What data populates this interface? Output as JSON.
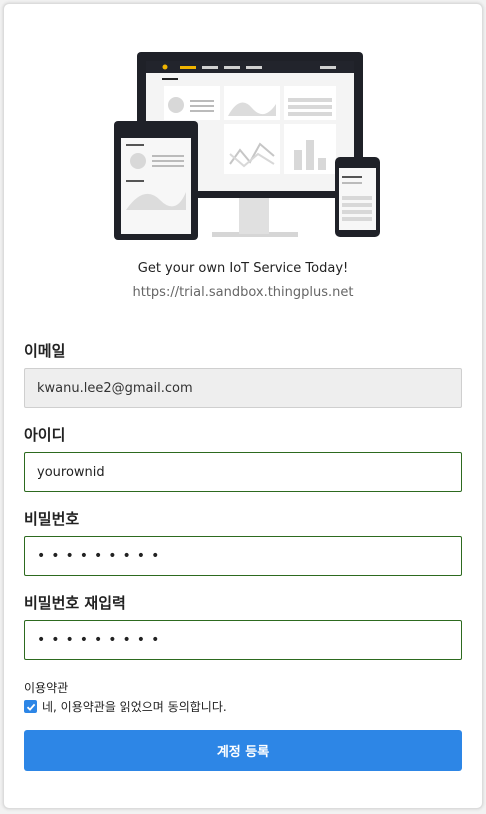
{
  "hero": {
    "tagline": "Get your own IoT Service Today!",
    "url": "https://trial.sandbox.thingplus.net"
  },
  "form": {
    "email": {
      "label": "이메일",
      "value": "kwanu.lee2@gmail.com"
    },
    "userid": {
      "label": "아이디",
      "value": "yourownid"
    },
    "password": {
      "label": "비밀번호",
      "value": "•••••••••"
    },
    "password_confirm": {
      "label": "비밀번호 재입력",
      "value": "•••••••••"
    },
    "terms": {
      "title": "이용약관",
      "agree_label": "네, 이용약관을 읽었으며 동의합니다.",
      "checked": true
    },
    "submit_label": "계정 등록"
  },
  "colors": {
    "accent": "#2d86e6",
    "focus_border": "#2d6a1f",
    "readonly_bg": "#eeeeee"
  }
}
